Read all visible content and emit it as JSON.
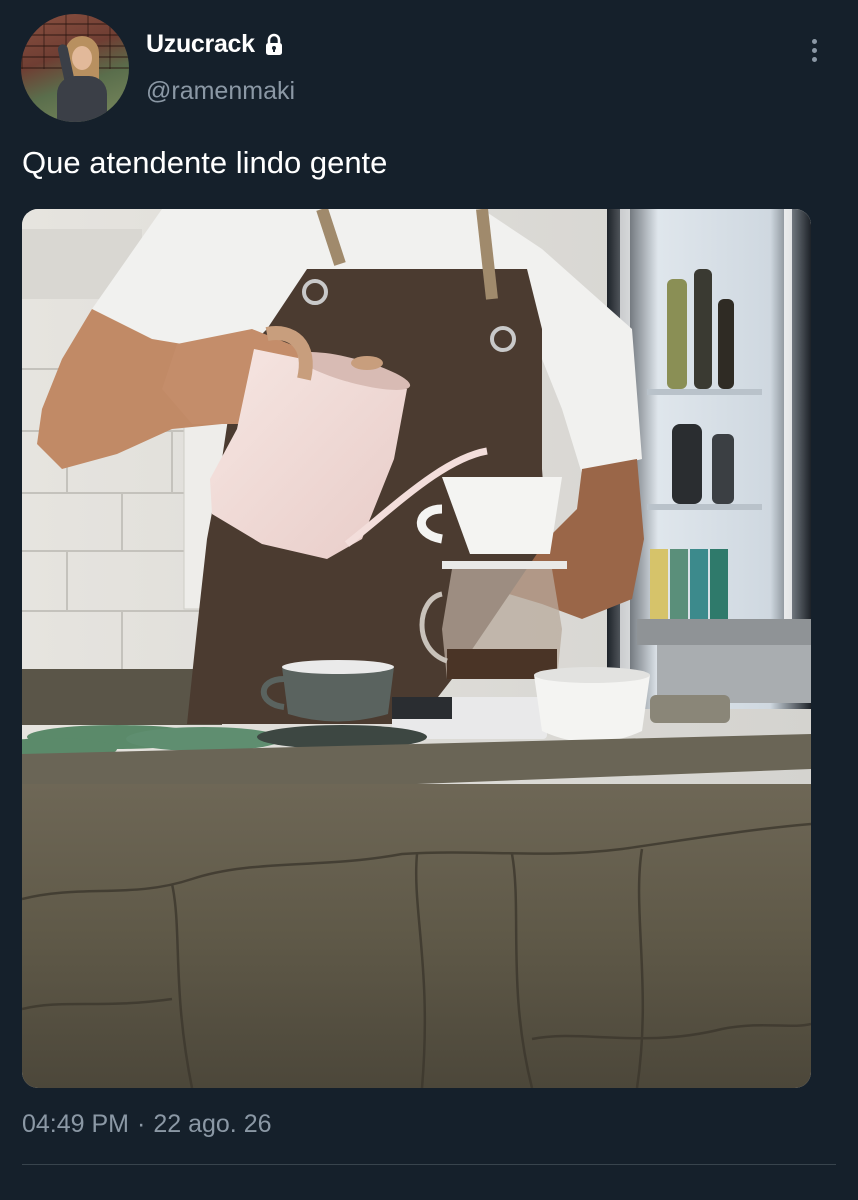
{
  "author": {
    "display_name": "Uzucrack",
    "handle": "@ramenmaki",
    "protected": true
  },
  "icons": {
    "lock": "lock-icon",
    "more": "more-vertical-icon"
  },
  "tweet": {
    "text": "Que atendente lindo gente",
    "time": "04:49 PM",
    "separator": "·",
    "date": "22 ago. 26"
  },
  "colors": {
    "background": "#15202b",
    "secondary_text": "#8b98a5",
    "divider": "#38444d"
  }
}
